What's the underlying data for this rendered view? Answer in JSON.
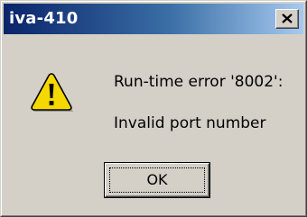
{
  "window": {
    "title": "iva-410"
  },
  "titlebar": {
    "close_icon": "close-icon"
  },
  "message": {
    "icon": "warning-icon",
    "line1": "Run-time error '8002':",
    "line2": "Invalid port number"
  },
  "buttons": {
    "ok_label": "OK"
  },
  "colors": {
    "titlebar_start": "#0a246a",
    "titlebar_end": "#a6caf0",
    "dialog_bg": "#d4d0c8",
    "warning_yellow": "#f5d800"
  }
}
